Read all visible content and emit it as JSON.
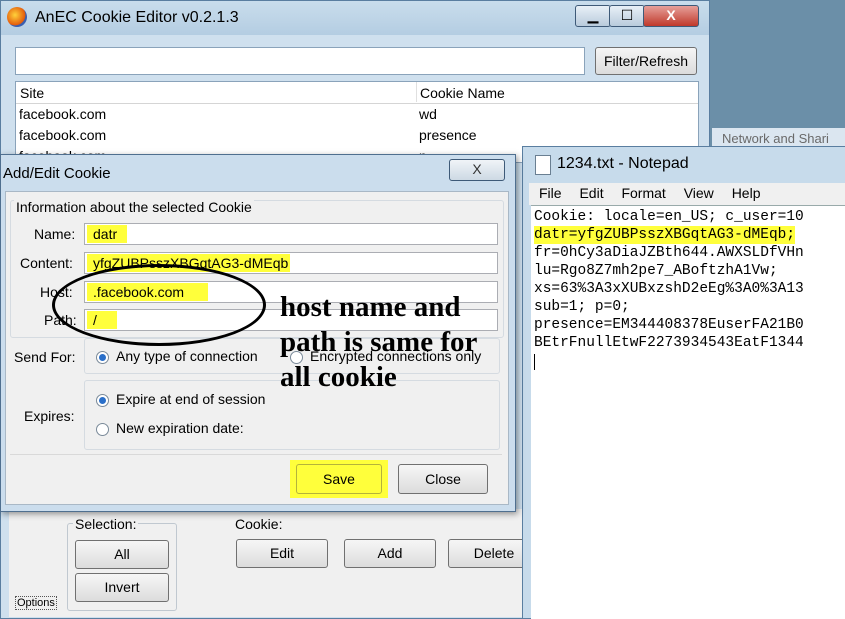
{
  "main_window": {
    "title": "AnEC Cookie Editor v0.2.1.3",
    "caption_buttons": {
      "minimize": "▁",
      "maximize": "☐",
      "close": "X"
    },
    "filter_value": "",
    "filter_button": "Filter/Refresh",
    "columns": [
      "Site",
      "Cookie Name"
    ],
    "rows": [
      {
        "site": "facebook.com",
        "name": "wd"
      },
      {
        "site": "facebook.com",
        "name": "presence"
      },
      {
        "site": "facebook.com",
        "name": "p"
      }
    ],
    "selection_label": "Selection:",
    "selection_all": "All",
    "selection_invert": "Invert",
    "cookie_label": "Cookie:",
    "cookie_edit": "Edit",
    "cookie_add": "Add",
    "cookie_delete": "Delete",
    "options": "Options",
    "background_text": "Network and Shari"
  },
  "dialog": {
    "title": "Add/Edit Cookie",
    "close": "X",
    "group_title": "Information about the selected Cookie",
    "name_label": "Name:",
    "name_value": "datr",
    "content_label": "Content:",
    "content_value": "yfgZUBPsszXBGqtAG3-dMEqb",
    "host_label": "Host:",
    "host_value": ".facebook.com",
    "path_label": "Path:",
    "path_value": "/",
    "send_for_label": "Send For:",
    "send_any": "Any type of connection",
    "send_encrypted": "Encrypted connections only",
    "expires_label": "Expires:",
    "expire_session": "Expire at end of session",
    "expire_new": "New expiration date:",
    "save": "Save",
    "close_button": "Close"
  },
  "annotation": {
    "lines": [
      "host name and",
      "path is same for",
      "all cookie"
    ]
  },
  "notepad": {
    "title": "1234.txt - Notepad",
    "menu": [
      "File",
      "Edit",
      "Format",
      "View",
      "Help"
    ],
    "lines": [
      "Cookie: locale=en_US; c_user=10",
      "datr=yfgZUBPsszXBGqtAG3-dMEqb;",
      "fr=0hCy3aDiaJZBth644.AWXSLDfVHn",
      "lu=Rgo8Z7mh2pe7_ABoftzhA1Vw;",
      "xs=63%3A3xXUBxzshD2eEg%3A0%3A13",
      "sub=1; p=0;",
      "presence=EM344408378EuserFA21B0",
      "BEtrFnullEtwF2273934543EatF1344"
    ]
  },
  "colors": {
    "highlight": "#ffff3b",
    "accent": "#2a6fc9"
  }
}
